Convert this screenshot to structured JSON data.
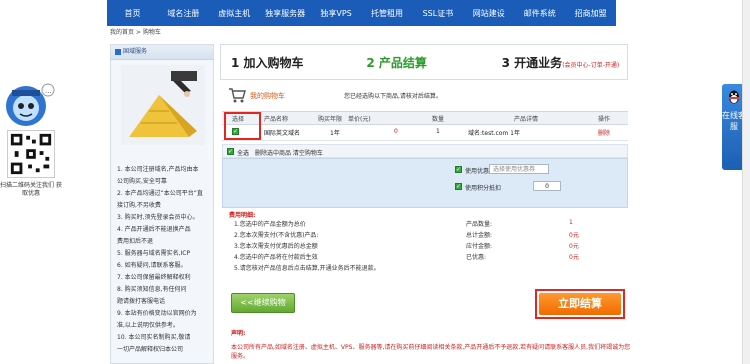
{
  "nav": {
    "items": [
      "首页",
      "域名注册",
      "虚拟主机",
      "独享服务器",
      "独享VPS",
      "托管租用",
      "SSL证书",
      "网站建设",
      "邮件系统",
      "招商加盟"
    ]
  },
  "breadcrumb": "我的首页 > 购物车",
  "left_ad": {
    "header": "国域服务",
    "lines": [
      "1. 本公司注册域名,产品均由本",
      "公司购买,安全可靠",
      "2. 本产品均通过“本公司平台”直",
      "接订购,不另收费",
      "3. 购买时,须先登录会员中心。",
      "4. 产品开通后不能退换产品",
      "费用扣后不退",
      "5. 服务器与域名需实名,ICP",
      "6. 如有疑问,请联系客服。",
      "7. 本公司保留最终解释权利",
      "8. 购买须知信息,有任何问",
      "题请拨打客服电话",
      "9. 本站有价格变动以官网价为",
      "准,以上说明仅供参考。",
      "10. 本公司实名制购买,敬请",
      "一切产品解释权归本公司"
    ]
  },
  "steps": [
    {
      "label": "1 加入购物车",
      "active": false,
      "note": ""
    },
    {
      "label": "2 产品结算",
      "active": true,
      "note": ""
    },
    {
      "label": "3 开通业务",
      "active": false,
      "note": "(会员中心-订单-开通)"
    }
  ],
  "cart": {
    "title": "我的购物车",
    "description": "您已经选购以下商品,请核对后结算。"
  },
  "table": {
    "headers": [
      "选择",
      "产品名称",
      "购买年限",
      "单价(元)",
      "数量",
      "产品详情",
      "操作"
    ],
    "row": {
      "checked": true,
      "name": "国际英文域名",
      "years": "1年",
      "price": "0",
      "qty": "1",
      "detail": "域名:test.com 1年",
      "action": "删除"
    }
  },
  "options": {
    "select_all": "全选",
    "bar_text": "删除选中商品 清空购物车",
    "coupon_label": "使用优惠券",
    "coupon_placeholder": "选择使用优惠券",
    "points_label": "使用积分抵扣",
    "points_value": "0"
  },
  "notes": {
    "title": "费用明细:",
    "lines": [
      {
        "text": "1.您选中的产品金额为总价",
        "mid": "产品数量:",
        "val": "1"
      },
      {
        "text": "2.您本次需支付(不含优惠)产品:",
        "mid": "总计金额:",
        "val": "0元"
      },
      {
        "text": "3.您本次需支付优惠后的总金额",
        "mid": "应付金额:",
        "val": "0元"
      },
      {
        "text": "4.您选中的产品将在付款后生效",
        "mid": "已优惠:",
        "val": "0元"
      },
      {
        "text": "5.请您核对产品信息后点击结算,开通业务后不能退款。",
        "mid": "",
        "val": ""
      }
    ]
  },
  "buttons": {
    "continue": "<<继续购物",
    "checkout": "立即结算"
  },
  "declaration": {
    "title": "声明:",
    "text": "本公司所有产品,如域名注册、虚拟主机、VPS、服务器等,请在购买前仔细阅读相关条款,产品开通后不予退款,若有疑问请联系客服人员,我们将竭诚为您服务。"
  },
  "side": {
    "qr_text": "扫描二维码关注我们 获取优惠",
    "service_label": "在线客服"
  },
  "colors": {
    "nav": "#1a5cb8",
    "accent_green": "#2c9c2c",
    "accent_red": "#d21c1c",
    "checkout": "#f06a00"
  }
}
